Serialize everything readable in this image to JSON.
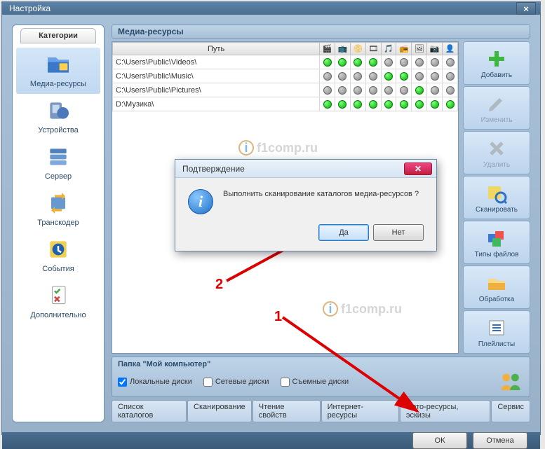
{
  "window": {
    "title": "Настройка",
    "close": "×"
  },
  "sidebar": {
    "header": "Категории",
    "items": [
      {
        "label": "Медиа-ресурсы"
      },
      {
        "label": "Устройства"
      },
      {
        "label": "Сервер"
      },
      {
        "label": "Транскодер"
      },
      {
        "label": "События"
      },
      {
        "label": "Дополнительно"
      }
    ]
  },
  "panel": {
    "title": "Медиа-ресурсы"
  },
  "table": {
    "path_header": "Путь",
    "rows": [
      {
        "path": "C:\\Users\\Public\\Videos\\",
        "flags": [
          "green",
          "green",
          "green",
          "green",
          "grey",
          "grey",
          "grey",
          "grey",
          "grey"
        ]
      },
      {
        "path": "C:\\Users\\Public\\Music\\",
        "flags": [
          "grey",
          "grey",
          "grey",
          "grey",
          "green",
          "green",
          "grey",
          "grey",
          "grey"
        ]
      },
      {
        "path": "C:\\Users\\Public\\Pictures\\",
        "flags": [
          "grey",
          "grey",
          "grey",
          "grey",
          "grey",
          "grey",
          "green",
          "grey",
          "grey"
        ]
      },
      {
        "path": "D:\\Музика\\",
        "flags": [
          "green",
          "green",
          "green",
          "green",
          "green",
          "green",
          "green",
          "green",
          "green"
        ]
      }
    ]
  },
  "side_buttons": [
    {
      "label": "Добавить",
      "name": "add-button",
      "enabled": true
    },
    {
      "label": "Изменить",
      "name": "edit-button",
      "enabled": false
    },
    {
      "label": "Удалить",
      "name": "delete-button",
      "enabled": false
    },
    {
      "label": "Сканировать",
      "name": "scan-button",
      "enabled": true
    },
    {
      "label": "Типы файлов",
      "name": "filetypes-button",
      "enabled": true
    },
    {
      "label": "Обработка",
      "name": "processing-button",
      "enabled": true
    },
    {
      "label": "Плейлисты",
      "name": "playlists-button",
      "enabled": true
    }
  ],
  "folder_panel": {
    "title": "Папка \"Мой компьютер\"",
    "checks": [
      {
        "label": "Локальные диски",
        "checked": true
      },
      {
        "label": "Сетевые диски",
        "checked": false
      },
      {
        "label": "Съемные диски",
        "checked": false
      }
    ]
  },
  "tabs": [
    "Список каталогов",
    "Сканирование",
    "Чтение свойств",
    "Интернет-ресурсы",
    "Фото-ресурсы, эскизы",
    "Сервис"
  ],
  "bottom": {
    "ok": "ОК",
    "cancel": "Отмена"
  },
  "dialog": {
    "title": "Подтверждение",
    "text": "Выполнить сканирование каталогов медиа-ресурсов ?",
    "yes": "Да",
    "no": "Нет"
  },
  "annotations": {
    "label1": "1",
    "label2": "2"
  },
  "watermark": "f1comp.ru"
}
